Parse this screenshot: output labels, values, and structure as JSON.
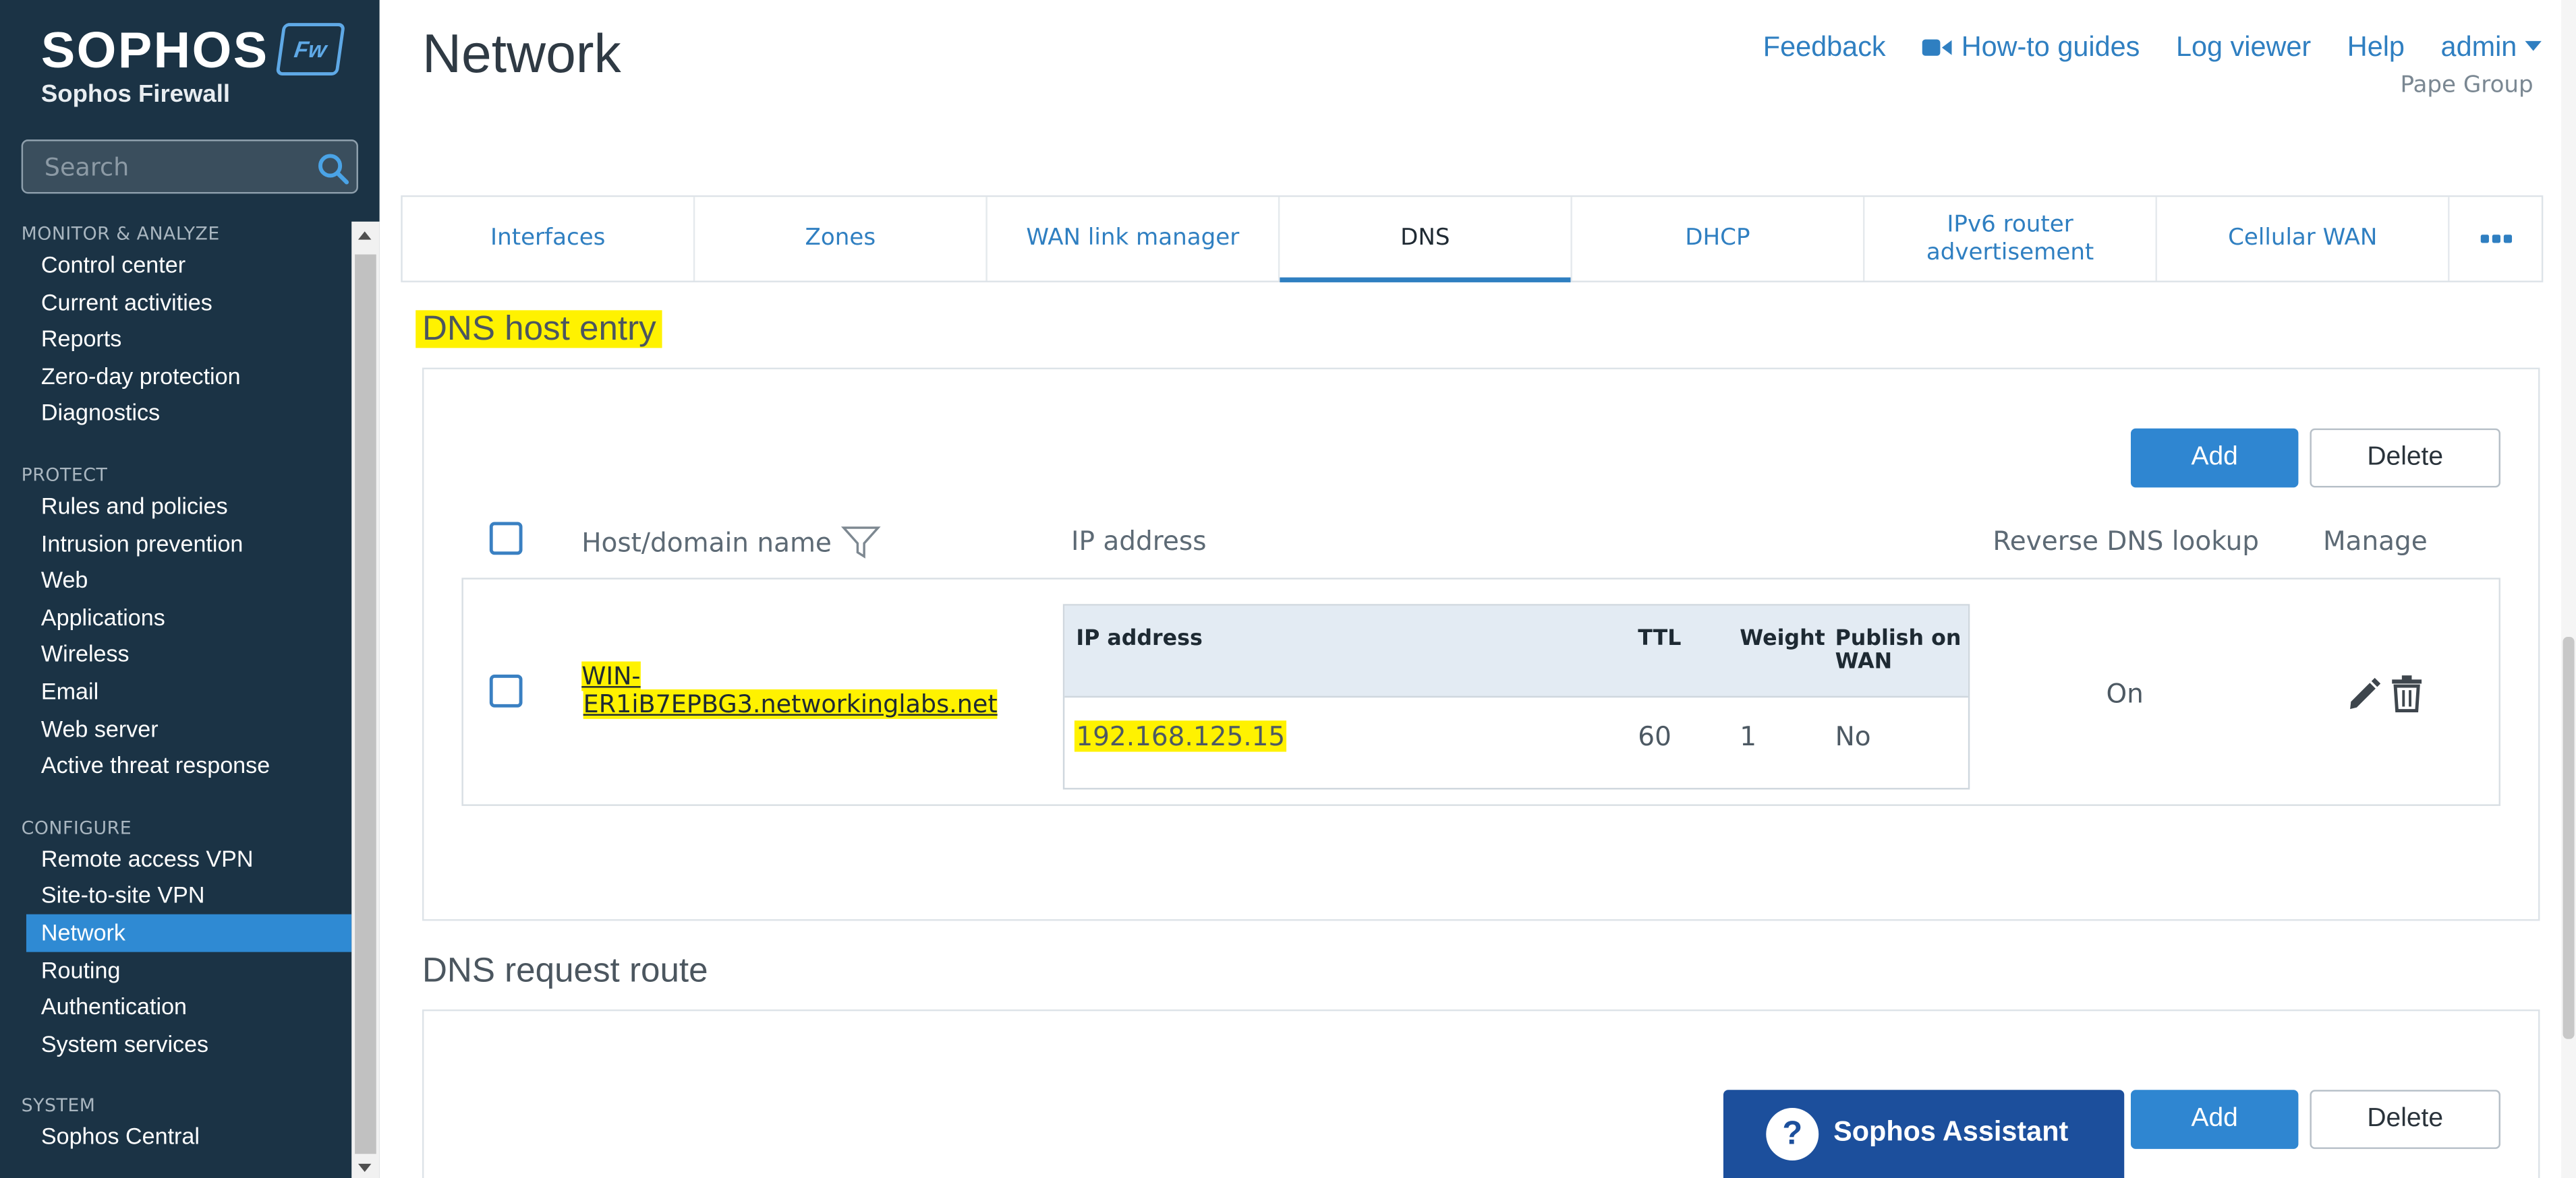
{
  "brand": {
    "name": "SOPHOS",
    "product": "Sophos Firewall",
    "badge": "Fw"
  },
  "search": {
    "placeholder": "Search"
  },
  "sidebar": {
    "sections": [
      {
        "title": "MONITOR & ANALYZE",
        "items": [
          "Control center",
          "Current activities",
          "Reports",
          "Zero-day protection",
          "Diagnostics"
        ]
      },
      {
        "title": "PROTECT",
        "items": [
          "Rules and policies",
          "Intrusion prevention",
          "Web",
          "Applications",
          "Wireless",
          "Email",
          "Web server",
          "Active threat response"
        ]
      },
      {
        "title": "CONFIGURE",
        "items": [
          "Remote access VPN",
          "Site-to-site VPN",
          "Network",
          "Routing",
          "Authentication",
          "System services"
        ]
      },
      {
        "title": "SYSTEM",
        "items": [
          "Sophos Central"
        ]
      }
    ],
    "active_item": "Network"
  },
  "header": {
    "title": "Network",
    "links": {
      "feedback": "Feedback",
      "howto": "How-to guides",
      "logviewer": "Log viewer",
      "help": "Help",
      "user": "admin"
    },
    "org": "Pape Group"
  },
  "tabs": [
    "Interfaces",
    "Zones",
    "WAN link manager",
    "DNS",
    "DHCP",
    "IPv6 router advertisement",
    "Cellular WAN"
  ],
  "active_tab": "DNS",
  "dns_host": {
    "title": "DNS host entry",
    "add_label": "Add",
    "delete_label": "Delete",
    "columns": {
      "host": "Host/domain name",
      "ip": "IP address",
      "reverse": "Reverse DNS lookup",
      "manage": "Manage"
    },
    "inner_columns": {
      "ip": "IP address",
      "ttl": "TTL",
      "weight": "Weight",
      "publish": "Publish on WAN"
    },
    "rows": [
      {
        "host_line1": "WIN-",
        "host_line2": "ER1iB7EPBG3.networkinglabs.net",
        "ip": "192.168.125.15",
        "ttl": "60",
        "weight": "1",
        "publish": "No",
        "reverse": "On"
      }
    ]
  },
  "dns_route": {
    "title": "DNS request route",
    "add_label": "Add",
    "delete_label": "Delete"
  },
  "assistant": {
    "label": "Sophos Assistant"
  },
  "colors": {
    "sidebar_bg": "#1b3345",
    "accent": "#2f86d1",
    "highlight": "#fff200"
  }
}
